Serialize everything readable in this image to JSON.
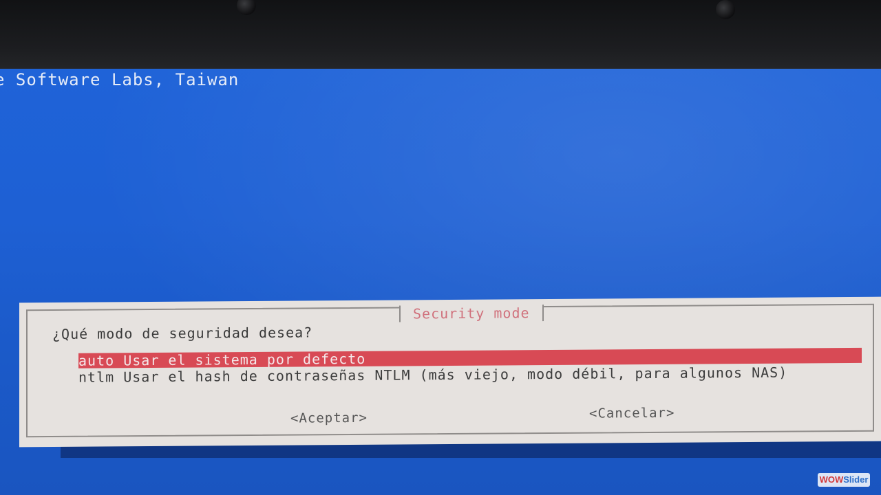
{
  "background": {
    "title_text": "e Software Labs, Taiwan"
  },
  "dialog": {
    "title": "Security mode",
    "question": "¿Qué modo de seguridad desea?",
    "options": [
      {
        "label": "auto Usar el sistema por defecto",
        "selected": true
      },
      {
        "label": "ntlm Usar el hash de contraseñas NTLM (más viejo, modo débil, para algunos NAS)",
        "selected": false
      }
    ],
    "accept_label": "<Aceptar>",
    "cancel_label": "<Cancelar>"
  },
  "watermark": {
    "part1": "WOW",
    "part2": "Slider"
  },
  "colors": {
    "screen_blue": "#1e60d4",
    "dialog_bg": "#e6e2df",
    "selection_red": "#d84a55",
    "title_pink": "#d0717c"
  }
}
